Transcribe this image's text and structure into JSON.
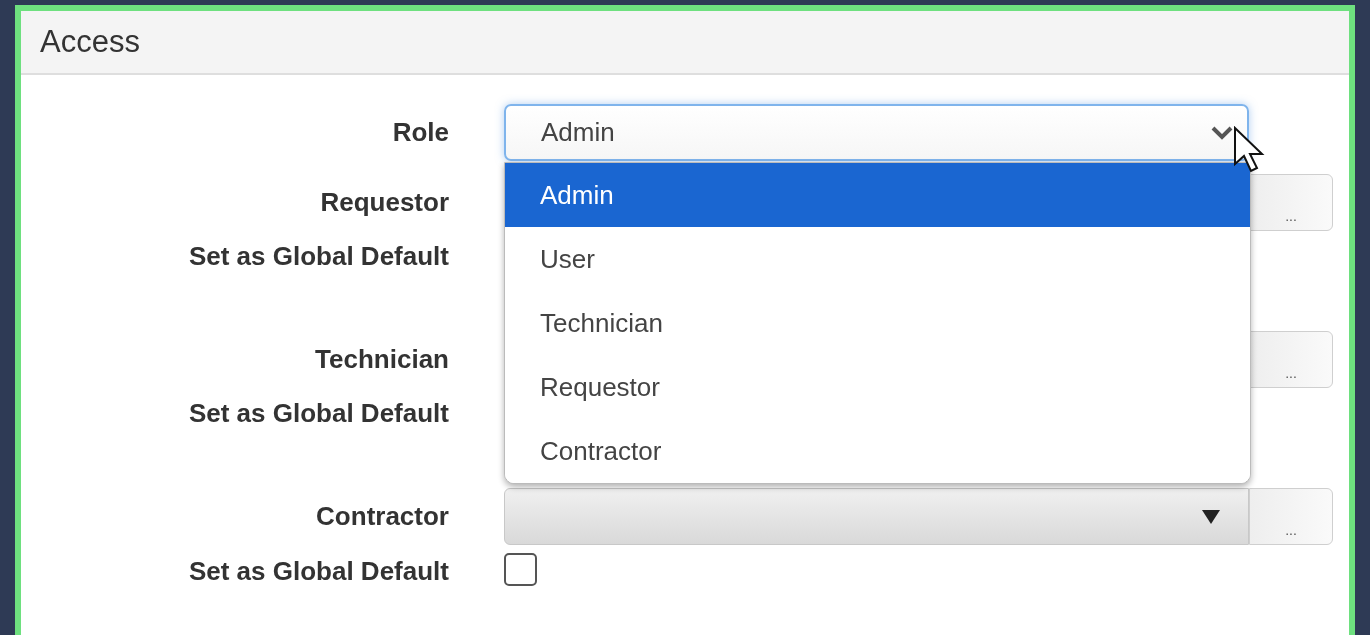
{
  "panel": {
    "title": "Access"
  },
  "role": {
    "label": "Role",
    "value": "Admin",
    "expanded": true,
    "options": [
      {
        "label": "Admin",
        "selected": true
      },
      {
        "label": "User",
        "selected": false
      },
      {
        "label": "Technician",
        "selected": false
      },
      {
        "label": "Requestor",
        "selected": false
      },
      {
        "label": "Contractor",
        "selected": false
      }
    ]
  },
  "groups": [
    {
      "label": "Requestor",
      "browse_button": "...",
      "default_label": "Set as Global Default"
    },
    {
      "label": "Technician",
      "browse_button": "...",
      "default_label": "Set as Global Default"
    },
    {
      "label": "Contractor",
      "browse_button": "...",
      "default_label": "Set as Global Default",
      "default_checked": false
    }
  ]
}
